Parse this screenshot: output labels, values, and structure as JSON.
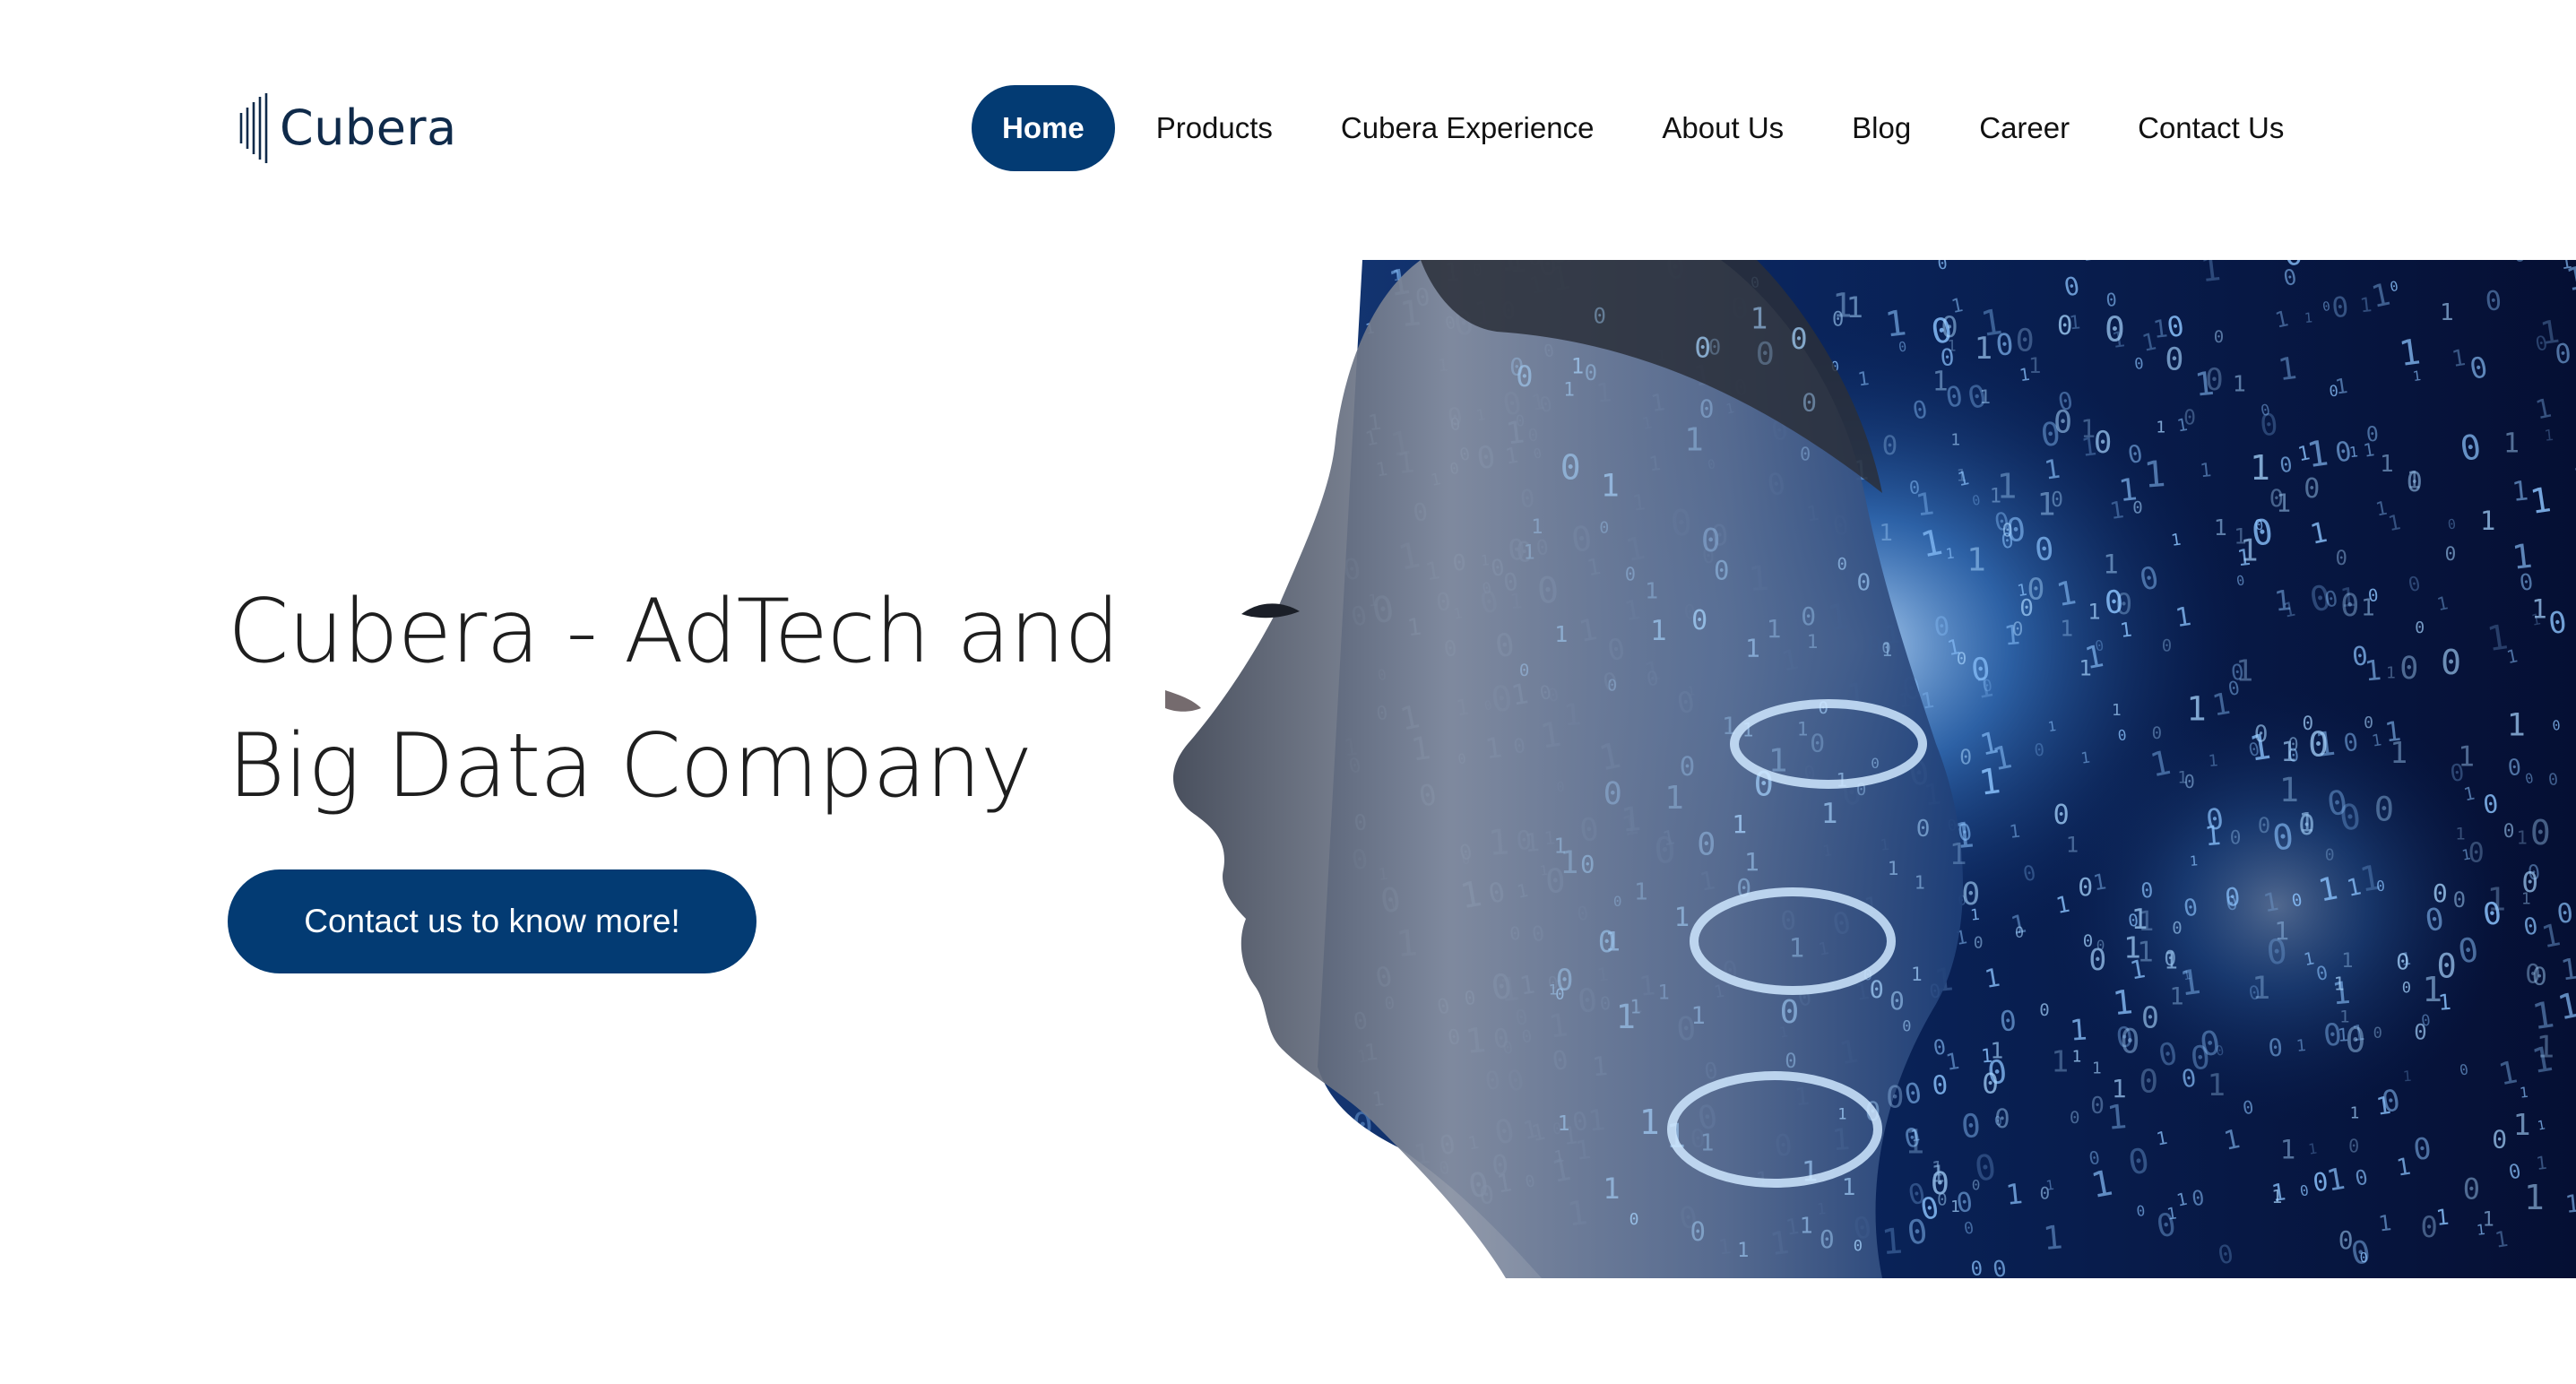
{
  "brand": {
    "name": "Cubera",
    "logo_icon": "vertical-bars-logo-icon"
  },
  "nav": {
    "items": [
      {
        "label": "Home",
        "active": true
      },
      {
        "label": "Products",
        "active": false
      },
      {
        "label": "Cubera Experience",
        "active": false
      },
      {
        "label": "About Us",
        "active": false
      },
      {
        "label": "Blog",
        "active": false
      },
      {
        "label": "Career",
        "active": false
      },
      {
        "label": "Contact Us",
        "active": false
      }
    ]
  },
  "hero": {
    "title_line1": "Cubera - AdTech and",
    "title_line2": "Big Data Company",
    "cta_label": "Contact us to know more!",
    "image_icon": "woman-profile-binary-data-image"
  },
  "colors": {
    "brand_navy": "#033b73",
    "logo_text": "#0f2a4a",
    "hero_image_dark": "#061a44",
    "hero_image_glow": "#5aa8ff"
  }
}
